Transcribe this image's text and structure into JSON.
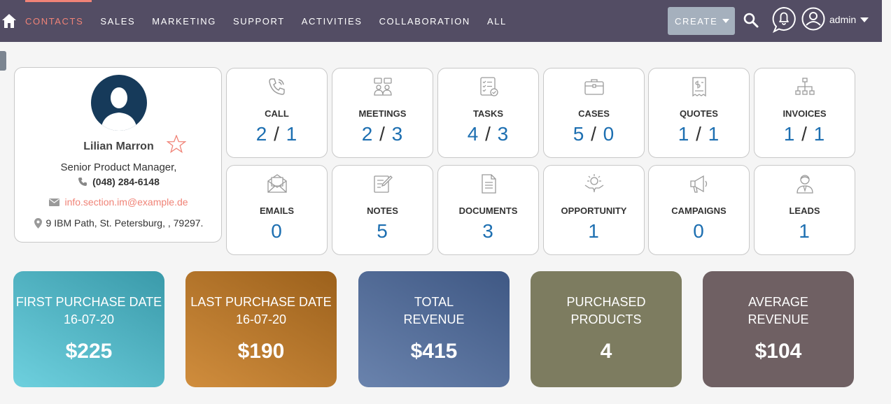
{
  "nav": {
    "items": [
      "CONTACTS",
      "SALES",
      "MARKETING",
      "SUPPORT",
      "ACTIVITIES",
      "COLLABORATION",
      "ALL"
    ],
    "active": "CONTACTS",
    "create_label": "CREATE",
    "user_label": "admin",
    "colors": {
      "bar": "#534d64",
      "active": "#f08377",
      "create": "#a5b0bd"
    }
  },
  "profile": {
    "name": "Lilian Marron",
    "title": "Senior Product Manager,",
    "phone": "(048) 284-6148",
    "email": "info.section.im@example.de",
    "address": "9 IBM Path, St. Petersburg, , 79297."
  },
  "tiles": [
    {
      "label": "CALL",
      "a": "2",
      "b": "1",
      "icon": "phone-icon"
    },
    {
      "label": "MEETINGS",
      "a": "2",
      "b": "3",
      "icon": "meeting-icon"
    },
    {
      "label": "TASKS",
      "a": "4",
      "b": "3",
      "icon": "tasks-icon"
    },
    {
      "label": "CASES",
      "a": "5",
      "b": "0",
      "icon": "briefcase-icon"
    },
    {
      "label": "QUOTES",
      "a": "1",
      "b": "1",
      "icon": "receipt-icon"
    },
    {
      "label": "INVOICES",
      "a": "1",
      "b": "1",
      "icon": "org-chart-icon"
    },
    {
      "label": "EMAILS",
      "value": "0",
      "icon": "envelope-icon"
    },
    {
      "label": "NOTES",
      "value": "5",
      "icon": "note-edit-icon"
    },
    {
      "label": "DOCUMENTS",
      "value": "3",
      "icon": "document-icon"
    },
    {
      "label": "OPPORTUNITY",
      "value": "1",
      "icon": "opportunity-icon"
    },
    {
      "label": "CAMPAIGNS",
      "value": "0",
      "icon": "megaphone-icon"
    },
    {
      "label": "LEADS",
      "value": "1",
      "icon": "person-icon"
    }
  ],
  "tile_separator": "/",
  "summary": [
    {
      "line1": "FIRST PURCHASE DATE",
      "line2": "16-07-20",
      "value": "$225"
    },
    {
      "line1": "LAST PURCHASE DATE",
      "line2": "16-07-20",
      "value": "$190"
    },
    {
      "line1": "TOTAL",
      "line2": "REVENUE",
      "value": "$415"
    },
    {
      "line1": "PURCHASED",
      "line2": "PRODUCTS",
      "value": "4"
    },
    {
      "line1": "AVERAGE",
      "line2": "REVENUE",
      "value": "$104"
    }
  ]
}
